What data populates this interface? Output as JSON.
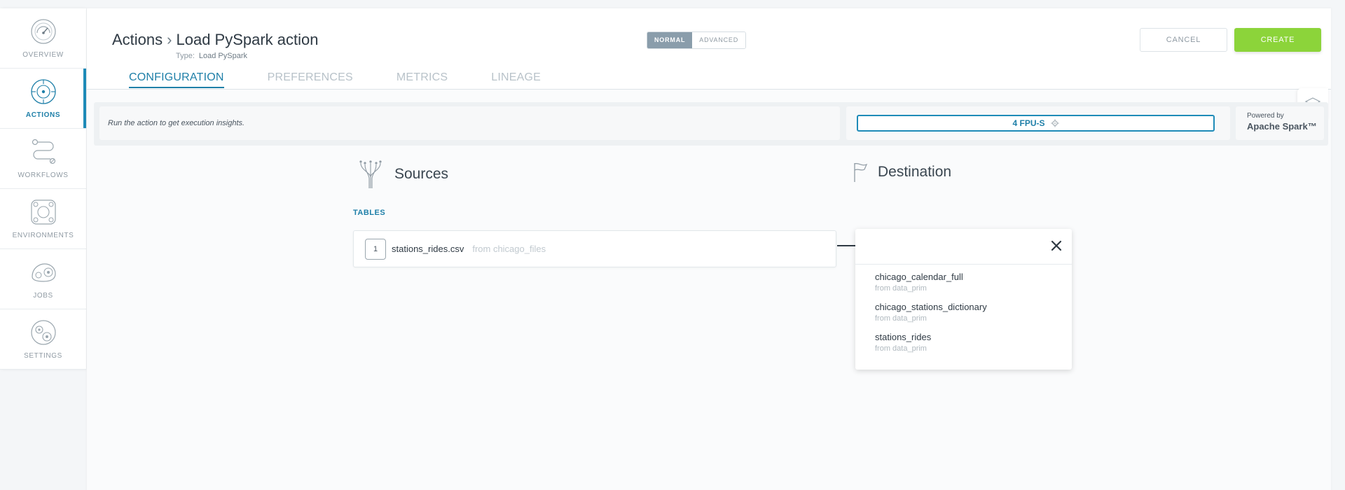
{
  "sidebar": {
    "items": [
      {
        "label": "OVERVIEW",
        "icon": "gauge-icon"
      },
      {
        "label": "ACTIONS",
        "icon": "target-icon",
        "active": true
      },
      {
        "label": "WORKFLOWS",
        "icon": "workflow-icon"
      },
      {
        "label": "ENVIRONMENTS",
        "icon": "environment-icon"
      },
      {
        "label": "JOBS",
        "icon": "jobs-icon"
      },
      {
        "label": "SETTINGS",
        "icon": "gears-icon"
      }
    ]
  },
  "header": {
    "breadcrumb_root": "Actions",
    "breadcrumb_current": "Load PySpark action",
    "type_label": "Type:",
    "type_value": "Load PySpark",
    "mode_normal": "NORMAL",
    "mode_advanced": "ADVANCED",
    "cancel_label": "CANCEL",
    "create_label": "CREATE"
  },
  "tabs": [
    {
      "label": "CONFIGURATION",
      "active": true
    },
    {
      "label": "PREFERENCES"
    },
    {
      "label": "METRICS"
    },
    {
      "label": "LINEAGE"
    }
  ],
  "insights": {
    "message": "Run the action to get execution insights.",
    "fpu": "4 FPU-S",
    "powered_by": "Powered by",
    "engine": "Apache Spark™"
  },
  "sources": {
    "title": "Sources",
    "tables_label": "TABLES",
    "rows": [
      {
        "num": "1",
        "name": "stations_rides.csv",
        "from": "from chicago_files"
      }
    ]
  },
  "destination": {
    "title": "Destination",
    "options": [
      {
        "name": "chicago_calendar_full",
        "from": "from data_prim"
      },
      {
        "name": "chicago_stations_dictionary",
        "from": "from data_prim"
      },
      {
        "name": "stations_rides",
        "from": "from data_prim"
      }
    ]
  },
  "colors": {
    "accent": "#1e7fa8",
    "create": "#8cd43a",
    "toggle_on": "#8a9dab"
  }
}
